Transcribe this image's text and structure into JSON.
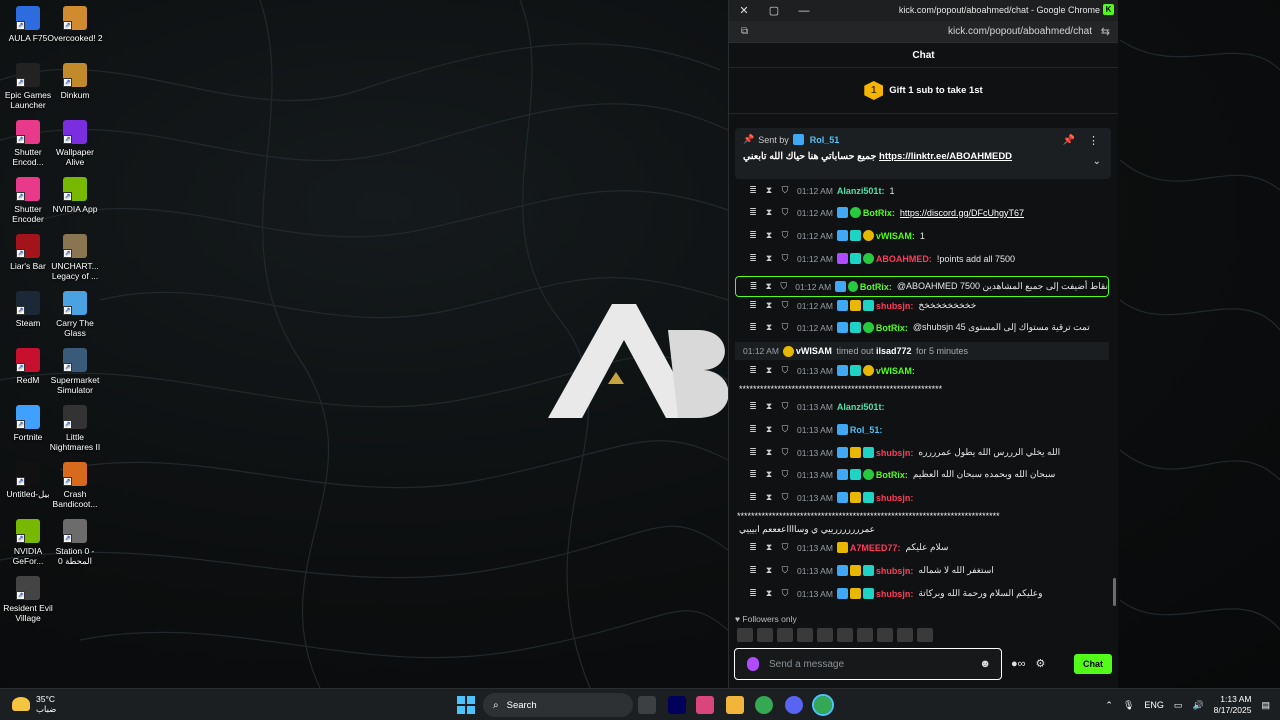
{
  "desktop": {
    "icons": [
      {
        "label": "AULA F75",
        "color": "#2d6cdf"
      },
      {
        "label": "Overcooked! 2",
        "color": "#d08a30"
      },
      {
        "label": "Epic Games Launcher",
        "color": "#222222"
      },
      {
        "label": "Dinkum",
        "color": "#c28a2b"
      },
      {
        "label": "Shutter Encod...",
        "color": "#e8398a"
      },
      {
        "label": "Wallpaper Alive",
        "color": "#7a2ee0"
      },
      {
        "label": "Shutter Encoder",
        "color": "#e8398a"
      },
      {
        "label": "NVIDIA App",
        "color": "#76b900"
      },
      {
        "label": "Liar's Bar",
        "color": "#a3141a"
      },
      {
        "label": "UNCHART... Legacy of ...",
        "color": "#8a7552"
      },
      {
        "label": "Steam",
        "color": "#1b2838"
      },
      {
        "label": "Carry The Glass",
        "color": "#4aa3e0"
      },
      {
        "label": "RedM",
        "color": "#c8102e"
      },
      {
        "label": "Supermarket Simulator",
        "color": "#3a5a7a"
      },
      {
        "label": "Fortnite",
        "color": "#3fa0ff"
      },
      {
        "label": "Little Nightmares II",
        "color": "#333333"
      },
      {
        "label": "Untitled-بيل",
        "color": "#111111"
      },
      {
        "label": "Crash Bandicoot...",
        "color": "#d86a1e"
      },
      {
        "label": "NVIDIA GeFor...",
        "color": "#76b900"
      },
      {
        "label": "Station 0 - المحطة 0",
        "color": "#6c6c6c"
      },
      {
        "label": "Resident Evil Village",
        "color": "#444444"
      }
    ]
  },
  "window": {
    "title": "kick.com/popout/aboahmed/chat - Google Chrome",
    "url": "kick.com/popout/aboahmed/chat"
  },
  "chat": {
    "header": "Chat",
    "gift_text": "Gift 1 sub to take 1st",
    "gift_count": "1",
    "pinned": {
      "sent_by_label": "Sent by",
      "sender": "Rol_51",
      "text": "جميع حساباتي هنا حياك الله تابعني",
      "link": "https://linktr.ee/ABOAHMEDD"
    },
    "messages": [
      {
        "time": "01:12 AM",
        "user": "Alanzi501t:",
        "color": "#4fe0a8",
        "text": "1",
        "badges": []
      },
      {
        "time": "01:12 AM",
        "user": "BotRix:",
        "color": "#53fc18",
        "text": "https://discord.gg/DFcUhgyT67",
        "badges": [
          "blue",
          "green"
        ],
        "link": true
      },
      {
        "time": "01:12 AM",
        "user": "vWISAM:",
        "color": "#53fc18",
        "text": "1",
        "badges": [
          "blue",
          "cyan",
          "gold"
        ]
      },
      {
        "time": "01:12 AM",
        "user": "ABOAHMED:",
        "color": "#ff3b5c",
        "text": "!points add all 7500",
        "badges": [
          "purple",
          "cyan",
          "green"
        ]
      },
      {
        "time": "01:12 AM",
        "user": "BotRix:",
        "color": "#53fc18",
        "text": "@ABOAHMED 7500 نقاط أضيفت إلى جميع المشاهدين",
        "badges": [
          "blue",
          "green"
        ],
        "highlight": true
      },
      {
        "time": "01:12 AM",
        "user": "shubsjn:",
        "color": "#ff3b5c",
        "text": "خخخخخخخخخخ",
        "badges": [
          "blue",
          "crown",
          "cyan"
        ]
      },
      {
        "time": "01:12 AM",
        "user": "BotRix:",
        "color": "#53fc18",
        "text": "@shubsjn 45 تمت ترقية مستواك إلى المستوى",
        "badges": [
          "blue",
          "cyan",
          "green"
        ]
      }
    ],
    "system": {
      "time": "01:12 AM",
      "actor": "vWISAM",
      "action": "timed out",
      "target": "ilsad772",
      "suffix": "for 5 minutes"
    },
    "messages2": [
      {
        "time": "01:13 AM",
        "user": "vWISAM:",
        "color": "#53fc18",
        "text": "",
        "badges": [
          "blue",
          "cyan",
          "gold"
        ]
      },
      {
        "time": "01:13 AM",
        "user": "Alanzi501t:",
        "color": "#4fe0a8",
        "text": "",
        "badges": []
      },
      {
        "time": "01:13 AM",
        "user": "Rol_51:",
        "color": "#4fc3f7",
        "text": "",
        "badges": [
          "blue"
        ]
      },
      {
        "time": "01:13 AM",
        "user": "shubsjn:",
        "color": "#ff3b5c",
        "text": "الله يخلي الرررس الله يطول عمرررره",
        "badges": [
          "blue",
          "crown",
          "cyan"
        ]
      },
      {
        "time": "01:13 AM",
        "user": "BotRix:",
        "color": "#53fc18",
        "text": "سبحان الله وبحمده سبحان الله العظيم",
        "badges": [
          "blue",
          "cyan",
          "green"
        ]
      },
      {
        "time": "01:13 AM",
        "user": "shubsjn:",
        "color": "#ff3b5c",
        "text": "",
        "badges": [
          "blue",
          "crown",
          "cyan"
        ]
      },
      {
        "time": "01:13 AM",
        "user": "A7MEED77:",
        "color": "#ff3b5c",
        "text": "سلام عليكم",
        "badges": [
          "crown"
        ]
      },
      {
        "time": "01:13 AM",
        "user": "shubsjn:",
        "color": "#ff3b5c",
        "text": "استغفر الله لا شماله",
        "badges": [
          "blue",
          "crown",
          "cyan"
        ]
      },
      {
        "time": "01:13 AM",
        "user": "shubsjn:",
        "color": "#ff3b5c",
        "text": "وعليكم السلام ورحمة الله وبركاتة",
        "badges": [
          "blue",
          "crown",
          "cyan"
        ]
      }
    ],
    "vwisam_continuation": "**********************************************************",
    "shubsjn_continuation": "***************************************************************************",
    "shubsjn_continuation2": "عمرررررررييي ي وسااااععععم ابيييي",
    "followers_only": "Followers only",
    "input_placeholder": "Send a message",
    "chat_button": "Chat"
  },
  "taskbar": {
    "temperature": "35°C",
    "weather_desc": "ضباب",
    "search_label": "Search",
    "language": "ENG",
    "time": "1:13 AM",
    "date": "8/17/2025"
  }
}
